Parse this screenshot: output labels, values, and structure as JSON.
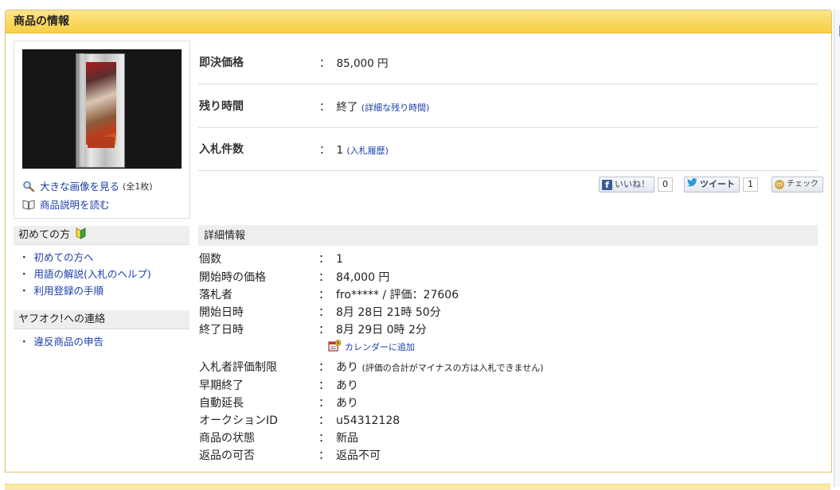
{
  "panel": {
    "title": "商品の情報"
  },
  "image_box": {
    "large_image_link": "大きな画像を見る",
    "image_count": "(全1枚)",
    "description_link": "商品説明を読む"
  },
  "sidebar": {
    "beginners": {
      "title": "初めての方",
      "items": [
        "初めての方へ",
        "用語の解説(入札のヘルプ)",
        "利用登録の手順"
      ]
    },
    "contact": {
      "title": "ヤフオク!への連絡",
      "items": [
        "違反商品の申告"
      ]
    }
  },
  "price": {
    "buyout_label": "即決価格",
    "buyout_value": "85,000 円",
    "remaining_label": "残り時間",
    "remaining_value": "終了",
    "remaining_link": "(詳細な残り時間)",
    "bids_label": "入札件数",
    "bids_value": "1",
    "bids_link": "(入札履歴)"
  },
  "social": {
    "like_label": "いいね！",
    "like_count": "0",
    "tweet_label": "ツイート",
    "tweet_count": "1",
    "check_label": "チェック"
  },
  "details": {
    "title": "詳細情報",
    "rows": [
      {
        "key": "個数",
        "value": "1"
      },
      {
        "key": "開始時の価格",
        "value": "84,000 円"
      },
      {
        "key": "落札者",
        "value": "fro***** / 評価：27606"
      },
      {
        "key": "開始日時",
        "value": "8月 28日 21時 50分"
      },
      {
        "key": "終了日時",
        "value": "8月 29日 0時 2分"
      },
      {
        "key": "入札者評価制限",
        "value": "あり",
        "note": "(評価の合計がマイナスの方は入札できません)"
      },
      {
        "key": "早期終了",
        "value": "あり"
      },
      {
        "key": "自動延長",
        "value": "あり"
      },
      {
        "key": "オークションID",
        "value": "u54312128"
      },
      {
        "key": "商品の状態",
        "value": "新品"
      },
      {
        "key": "返品の可否",
        "value": "返品不可"
      }
    ],
    "calendar_link": "カレンダーに追加",
    "colon": "："
  },
  "colors": {
    "header_gradient_top": "#fde58a",
    "header_gradient_bottom": "#f7cf43",
    "link": "#1a3fa8",
    "section_bg": "#eeeeee"
  }
}
